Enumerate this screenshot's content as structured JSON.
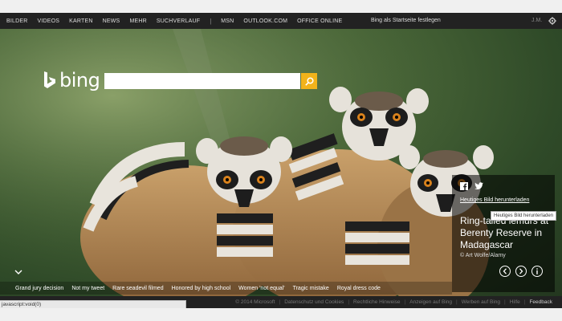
{
  "nav": {
    "items": [
      "BILDER",
      "VIDEOS",
      "KARTEN",
      "NEWS",
      "MEHR",
      "SUCHVERLAUF"
    ],
    "separator": "|",
    "items2": [
      "MSN",
      "OUTLOOK.COM",
      "OFFICE ONLINE"
    ],
    "homepage": "Bing als Startseite festlegen",
    "user": "J.M."
  },
  "logo": {
    "text": "bing"
  },
  "search": {
    "value": "",
    "placeholder": ""
  },
  "panel": {
    "download": "Heutiges Bild herunterladen",
    "tooltip": "Heutiges Bild herunterladen",
    "caption": "Ring-tailed lemurs at Berenty Reserve in Madagascar",
    "credit": "© Art Wolfe/Alamy"
  },
  "news": [
    "Grand jury decision",
    "Not my tweet",
    "Rare seadevil filmed",
    "Honored by high school",
    "Women 'not equal'",
    "Tragic mistake",
    "Royal dress code"
  ],
  "footer": {
    "items": [
      "© 2014 Microsoft",
      "Datenschutz und Cookies",
      "Rechtliche Hinweise",
      "Anzeigen auf Bing",
      "Werben auf Bing",
      "Hilfe",
      "Feedback"
    ]
  },
  "status": "javascript:void(0)",
  "colors": {
    "accent": "#f2b31b",
    "topbar": "#222222"
  }
}
